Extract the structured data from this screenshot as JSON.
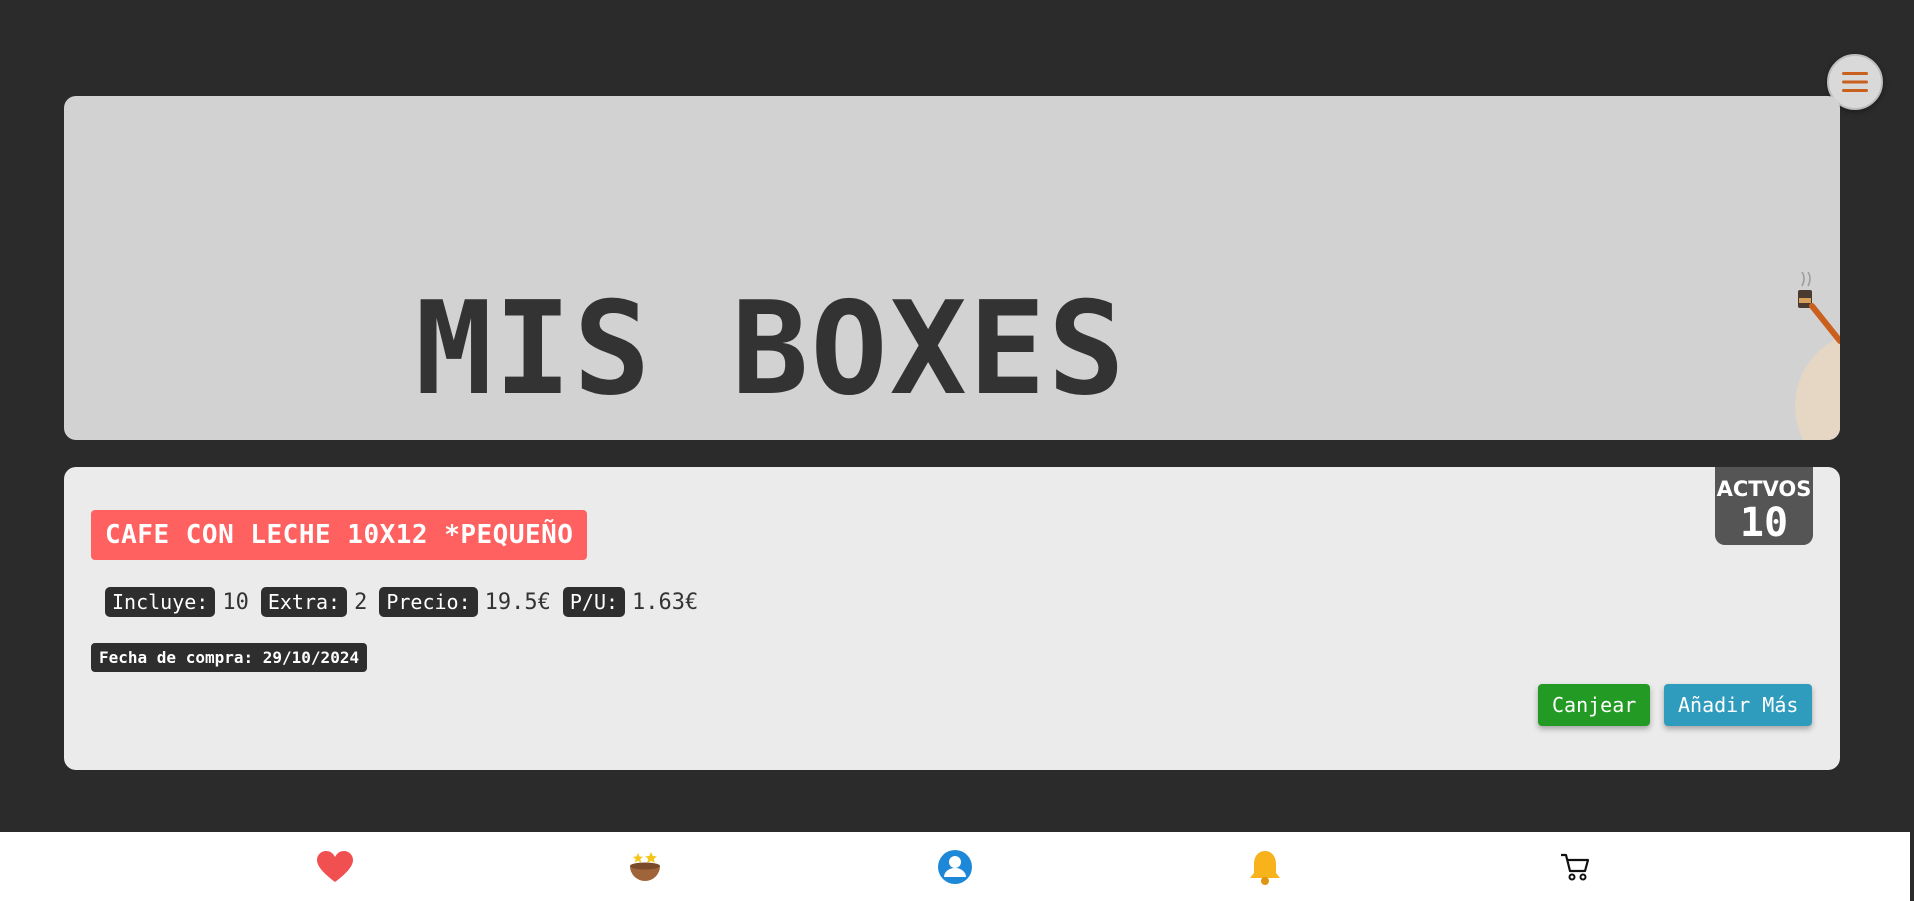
{
  "header": {
    "title": "MIS BOXES"
  },
  "menu": {
    "icon": "hamburger-menu-icon",
    "accent": "#c9601e"
  },
  "box": {
    "product": "CAFE CON LECHE 10X12 *PEQUEÑO",
    "active_label": "ACTVOS",
    "active_count": "10",
    "stats": [
      {
        "label": "Incluye:",
        "value": "10"
      },
      {
        "label": "Extra:",
        "value": "2"
      },
      {
        "label": "Precio:",
        "value": "19.5€"
      },
      {
        "label": "P/U:",
        "value": "1.63€"
      }
    ],
    "purchase_date": "Fecha de compra: 29/10/2024",
    "redeem_label": "Canjear",
    "add_more_label": "Añadir Más"
  },
  "colors": {
    "background": "#2b2b2b",
    "product_badge": "#ff6161",
    "redeem": "#239a23",
    "add_more": "#2f9cbd"
  },
  "bottom_nav": [
    {
      "icon": "heart-icon"
    },
    {
      "icon": "coffee-bowl-stars-icon"
    },
    {
      "icon": "user-profile-icon"
    },
    {
      "icon": "bell-icon"
    },
    {
      "icon": "shopping-cart-icon"
    }
  ]
}
